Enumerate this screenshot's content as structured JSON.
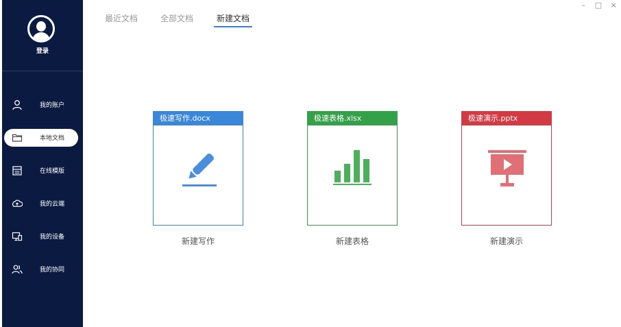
{
  "sidebar": {
    "login_label": "登录",
    "items": [
      {
        "label": "我的账户",
        "icon": "user-icon"
      },
      {
        "label": "本地文档",
        "icon": "folder-icon",
        "active": true
      },
      {
        "label": "在线模版",
        "icon": "template-icon"
      },
      {
        "label": "我的云端",
        "icon": "cloud-upload-icon"
      },
      {
        "label": "我的设备",
        "icon": "devices-icon"
      },
      {
        "label": "我的协同",
        "icon": "collaboration-icon"
      }
    ]
  },
  "tabs": [
    {
      "label": "最近文档"
    },
    {
      "label": "全部文档"
    },
    {
      "label": "新建文档",
      "active": true
    }
  ],
  "window_controls": {
    "minimize": "–",
    "maximize": "□",
    "close": "×"
  },
  "cards": [
    {
      "header": "极速写作.docx",
      "caption": "新建写作",
      "color": "#3a86d9",
      "icon": "pen-icon"
    },
    {
      "header": "极速表格.xlsx",
      "caption": "新建表格",
      "color": "#34a14a",
      "icon": "bar-chart-icon"
    },
    {
      "header": "极速演示.pptx",
      "caption": "新建演示",
      "color": "#d23a44",
      "icon": "presentation-icon"
    }
  ],
  "colors": {
    "sidebar_bg": "#0b1a40",
    "accent": "#3a7fd5"
  }
}
